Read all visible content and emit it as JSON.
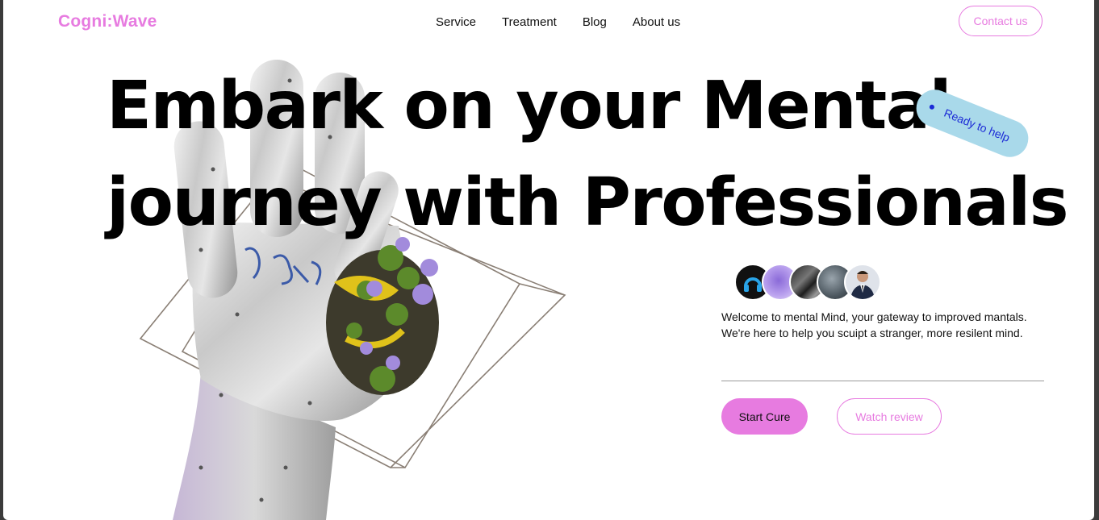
{
  "brand": {
    "logo": "Cogni:Wave",
    "accent": "#e77be0"
  },
  "nav": {
    "items": [
      {
        "label": "Service"
      },
      {
        "label": "Treatment"
      },
      {
        "label": "Blog"
      },
      {
        "label": "About us"
      }
    ],
    "contact_label": "Contact us"
  },
  "hero": {
    "headline_line1": "Embark on your Mental",
    "headline_line2": "journey with Professionals",
    "badge": "Ready to help",
    "badge_color": "#a9d9ea",
    "art_icon": "hand-with-flowers-and-wireframe-cube-image",
    "avatars": [
      {
        "icon": "headphones-avatar"
      },
      {
        "icon": "purple-flower-avatar"
      },
      {
        "icon": "abstract-dark-avatar"
      },
      {
        "icon": "landscape-avatar"
      },
      {
        "icon": "man-in-suit-avatar"
      }
    ],
    "welcome_text": "Welcome to mental Mind, your gateway to improved mantals. We're here to help you scuipt a stranger, more resilent mind.",
    "start_label": "Start Cure",
    "watch_label": "Watch review"
  }
}
